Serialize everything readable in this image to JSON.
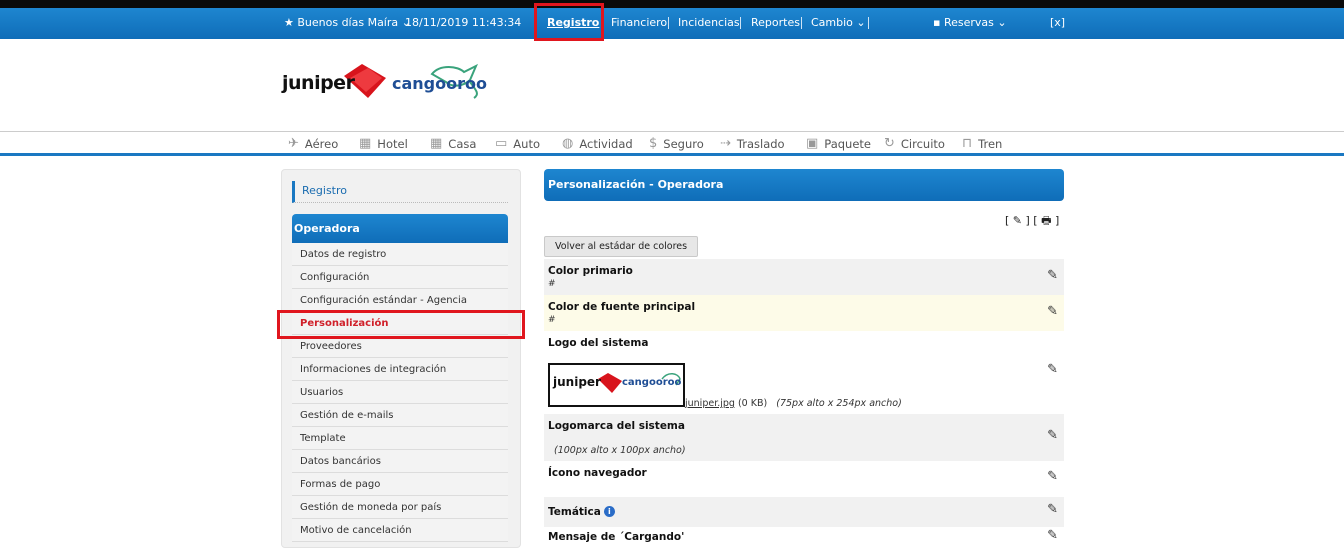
{
  "topbar": {
    "greeting": "★ Buenos días Maíra ⌄",
    "datetime": "18/11/2019 11:43:34",
    "registro": "Registro",
    "financiero": "Financiero",
    "incidencias": "Incidencias",
    "reportes": "Reportes",
    "cambio": "Cambio ⌄",
    "reservas": "Reservas ⌄",
    "close": "[x]"
  },
  "brand": {
    "juniper": "juniper",
    "cangooroo": "cangooroo"
  },
  "products": [
    "Aéreo",
    "Hotel",
    "Casa",
    "Auto",
    "Actividad",
    "Seguro",
    "Traslado",
    "Paquete",
    "Circuito",
    "Tren"
  ],
  "sidebar": {
    "section_title": "Registro",
    "group_title": "Operadora",
    "items": [
      "Datos de registro",
      "Configuración",
      "Configuración estándar - Agencia",
      "Personalización",
      "Proveedores",
      "Informaciones de integración",
      "Usuarios",
      "Gestión de e-mails",
      "Template",
      "Datos bancários",
      "Formas de pago",
      "Gestión de moneda por país",
      "Motivo de cancelación"
    ]
  },
  "main": {
    "title": "Personalización - Operadora",
    "tools": "[ ✎ ] [ 🖶 ]",
    "reset_button": "Volver al estádar de colores",
    "rows": {
      "primary_color": {
        "label": "Color primario",
        "value": "#"
      },
      "font_color": {
        "label": "Color de fuente principal",
        "value": "#"
      },
      "logo": {
        "label": "Logo del sistema",
        "file": "juniper.jpg",
        "size": " (0 KB)",
        "dims": "(75px alto x 254px ancho)"
      },
      "logomark": {
        "label": "Logomarca del sistema",
        "dims": "(100px alto x 100px ancho)"
      },
      "favicon": {
        "label": "Ícono navegador"
      },
      "theme": {
        "label": "Temática"
      },
      "loading": {
        "label": "Mensaje de ´Cargando'"
      }
    }
  },
  "colors": {
    "blue": "#1a78c2",
    "red_highlight": "#e0161e",
    "selected_text": "#d0202a",
    "highlight_row": "#fdfbe8"
  }
}
